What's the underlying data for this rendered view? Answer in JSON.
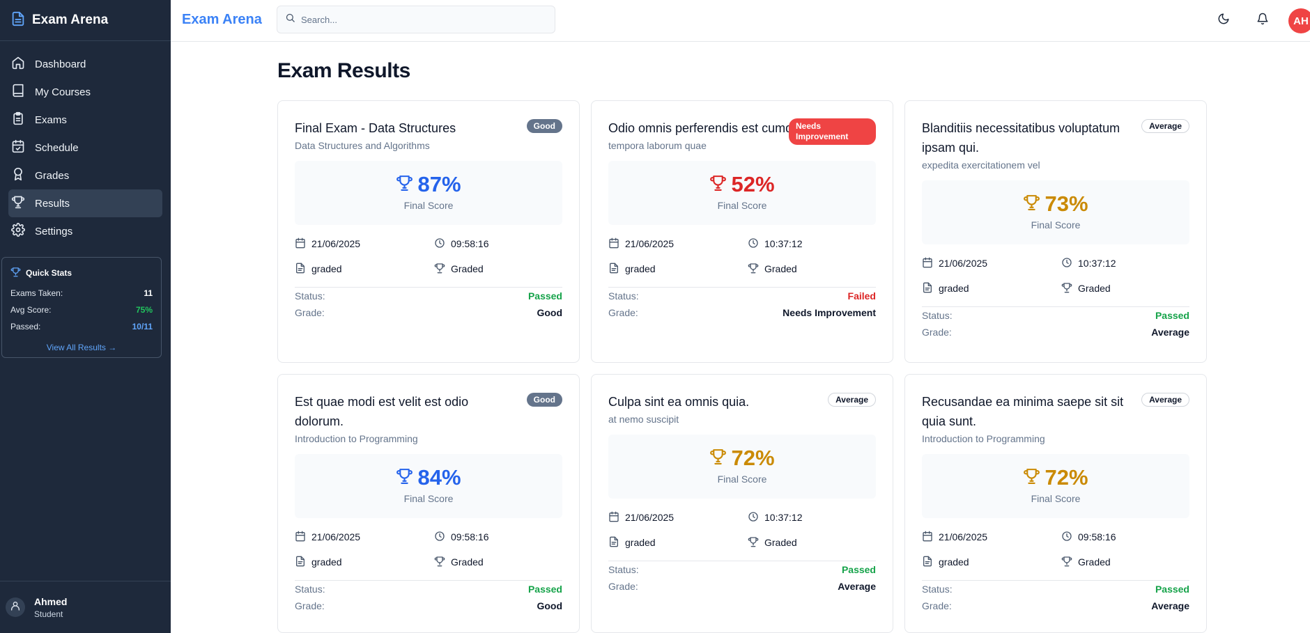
{
  "app": {
    "title": "Exam Arena"
  },
  "colors": {
    "blue": "#2563eb",
    "red": "#dc2626",
    "amber": "#ca8a04",
    "sidebar": "#1e293b",
    "accent": "#3b82f6"
  },
  "sidebar": {
    "items": [
      {
        "label": "Dashboard",
        "icon": "home-icon"
      },
      {
        "label": "My Courses",
        "icon": "book-icon"
      },
      {
        "label": "Exams",
        "icon": "clipboard-icon"
      },
      {
        "label": "Schedule",
        "icon": "calendar-check-icon"
      },
      {
        "label": "Grades",
        "icon": "award-icon"
      },
      {
        "label": "Results",
        "icon": "trophy-icon",
        "active": true
      },
      {
        "label": "Settings",
        "icon": "gear-icon"
      }
    ],
    "quick_stats": {
      "title": "Quick Stats",
      "rows": [
        {
          "label": "Exams Taken:",
          "value": "11",
          "color": "#ffffff"
        },
        {
          "label": "Avg Score:",
          "value": "75%",
          "color": "#22c55e"
        },
        {
          "label": "Passed:",
          "value": "10/11",
          "color": "#60a5fa"
        }
      ],
      "link": "View All Results →"
    },
    "user": {
      "name": "Ahmed",
      "role": "Student"
    }
  },
  "header": {
    "title": "Exam Arena",
    "search_placeholder": "Search...",
    "avatar_initials": "AH"
  },
  "main": {
    "title": "Exam Results",
    "cards": [
      {
        "title": "Final Exam - Data Structures",
        "subtitle": "Data Structures and Algorithms",
        "badge": "Good",
        "badge_type": "good",
        "score": "87%",
        "score_color": "#2563eb",
        "score_label": "Final Score",
        "date": "21/06/2025",
        "time": "09:58:16",
        "type": "graded",
        "state": "Graded",
        "status_label": "Status:",
        "status": "Passed",
        "grade_label": "Grade:",
        "grade": "Good"
      },
      {
        "title": "Odio omnis perferendis est cumque.",
        "subtitle": "tempora laborum quae",
        "badge": "Needs Improvement",
        "badge_type": "needs",
        "score": "52%",
        "score_color": "#dc2626",
        "score_label": "Final Score",
        "date": "21/06/2025",
        "time": "10:37:12",
        "type": "graded",
        "state": "Graded",
        "status_label": "Status:",
        "status": "Failed",
        "grade_label": "Grade:",
        "grade": "Needs Improvement"
      },
      {
        "title": "Blanditiis necessitatibus voluptatum ipsam qui.",
        "subtitle": "expedita exercitationem vel",
        "badge": "Average",
        "badge_type": "average",
        "score": "73%",
        "score_color": "#ca8a04",
        "score_label": "Final Score",
        "date": "21/06/2025",
        "time": "10:37:12",
        "type": "graded",
        "state": "Graded",
        "status_label": "Status:",
        "status": "Passed",
        "grade_label": "Grade:",
        "grade": "Average"
      },
      {
        "title": "Est quae modi est velit est odio dolorum.",
        "subtitle": "Introduction to Programming",
        "badge": "Good",
        "badge_type": "good",
        "score": "84%",
        "score_color": "#2563eb",
        "score_label": "Final Score",
        "date": "21/06/2025",
        "time": "09:58:16",
        "type": "graded",
        "state": "Graded",
        "status_label": "Status:",
        "status": "Passed",
        "grade_label": "Grade:",
        "grade": "Good"
      },
      {
        "title": "Culpa sint ea omnis quia.",
        "subtitle": "at nemo suscipit",
        "badge": "Average",
        "badge_type": "average",
        "score": "72%",
        "score_color": "#ca8a04",
        "score_label": "Final Score",
        "date": "21/06/2025",
        "time": "10:37:12",
        "type": "graded",
        "state": "Graded",
        "status_label": "Status:",
        "status": "Passed",
        "grade_label": "Grade:",
        "grade": "Average"
      },
      {
        "title": "Recusandae ea minima saepe sit sit quia sunt.",
        "subtitle": "Introduction to Programming",
        "badge": "Average",
        "badge_type": "average",
        "score": "72%",
        "score_color": "#ca8a04",
        "score_label": "Final Score",
        "date": "21/06/2025",
        "time": "09:58:16",
        "type": "graded",
        "state": "Graded",
        "status_label": "Status:",
        "status": "Passed",
        "grade_label": "Grade:",
        "grade": "Average"
      }
    ]
  }
}
